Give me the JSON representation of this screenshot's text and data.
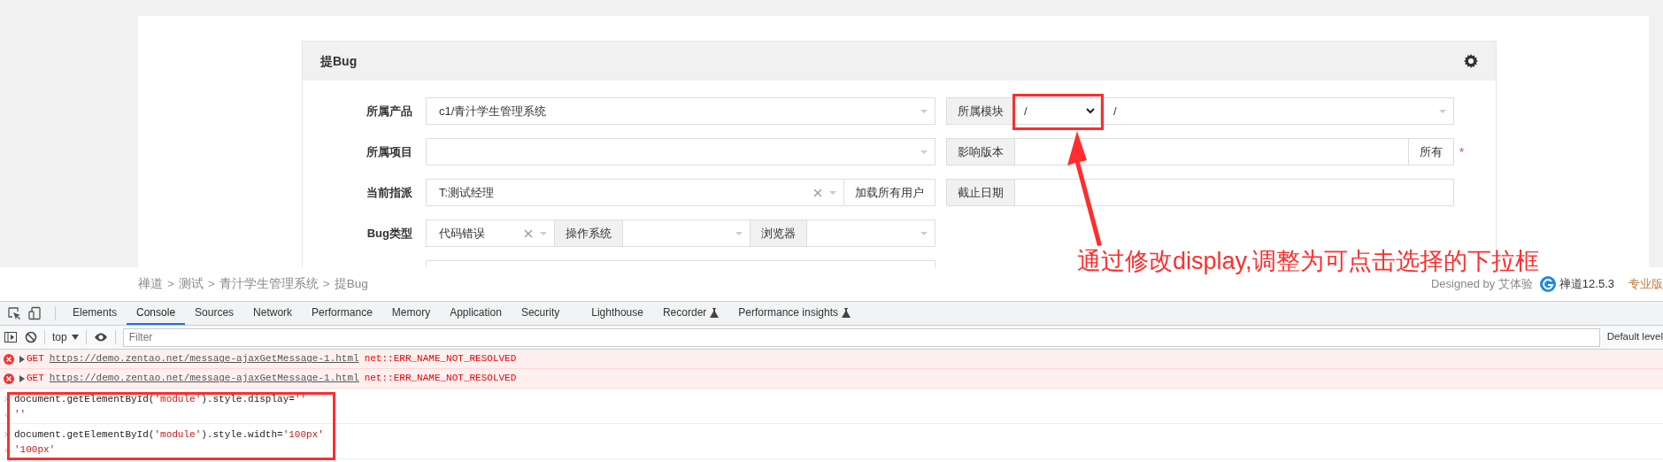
{
  "form": {
    "title": "提Bug",
    "rows": [
      {
        "label": "所属产品",
        "left": [
          {
            "kind": "select",
            "value": "c1/青汁学生管理系统"
          }
        ],
        "right": [
          {
            "kind": "addon",
            "text": "所属模块"
          },
          {
            "kind": "native-select",
            "value": "/"
          },
          {
            "kind": "select",
            "value": "/"
          }
        ]
      },
      {
        "label": "所属项目",
        "left": [
          {
            "kind": "select"
          }
        ],
        "right": [
          {
            "kind": "addon",
            "text": "影响版本"
          },
          {
            "kind": "input"
          },
          {
            "kind": "button",
            "text": "所有"
          }
        ],
        "required_mark": "*"
      },
      {
        "label": "当前指派",
        "left": [
          {
            "kind": "select",
            "value": "T:测试经理",
            "clearable": true
          },
          {
            "kind": "button",
            "text": "加载所有用户"
          }
        ],
        "right": [
          {
            "kind": "addon",
            "text": "截止日期"
          },
          {
            "kind": "input"
          }
        ]
      },
      {
        "label": "Bug类型",
        "left": [
          {
            "kind": "select",
            "value": "代码错误",
            "clearable": true
          },
          {
            "kind": "addon",
            "text": "操作系统"
          },
          {
            "kind": "select"
          },
          {
            "kind": "addon",
            "text": "浏览器"
          },
          {
            "kind": "select"
          }
        ]
      },
      {
        "left": [
          {
            "kind": "input"
          }
        ]
      }
    ]
  },
  "breadcrumb": [
    "禅道",
    ">",
    "测试",
    ">",
    "青汁学生管理系统",
    ">",
    "提Bug"
  ],
  "footer": {
    "designed_by": "Designed by 艾体验",
    "version": "禅道12.5.3",
    "edition": "专业版"
  },
  "annotation": {
    "text": "通过修改display,调整为可点击选择的下拉框"
  },
  "devtools": {
    "tabs": [
      {
        "label": "Elements",
        "selected": false
      },
      {
        "label": "Console",
        "selected": true
      },
      {
        "label": "Sources",
        "selected": false
      },
      {
        "label": "Network",
        "selected": false
      },
      {
        "label": "Performance",
        "selected": false
      },
      {
        "label": "Memory",
        "selected": false
      },
      {
        "label": "Application",
        "selected": false
      },
      {
        "label": "Security",
        "selected": false
      },
      {
        "label": "Lighthouse",
        "selected": false
      },
      {
        "label": "Recorder",
        "selected": false,
        "experimental": true
      },
      {
        "label": "Performance insights",
        "selected": false,
        "experimental": true
      }
    ],
    "context": "top",
    "filter_placeholder": "Filter",
    "level": "Default level",
    "messages": [
      {
        "kind": "error",
        "method": "GET",
        "url": "https://demo.zentao.net/message-ajaxGetMessage-1.html",
        "error": "net::ERR_NAME_NOT_RESOLVED"
      },
      {
        "kind": "error",
        "method": "GET",
        "url": "https://demo.zentao.net/message-ajaxGetMessage-1.html",
        "error": "net::ERR_NAME_NOT_RESOLVED"
      },
      {
        "kind": "input",
        "code": "document.getElementById('module').style.display=''"
      },
      {
        "kind": "result",
        "code": "''"
      },
      {
        "kind": "input",
        "code": "document.getElementById('module').style.width='100px'"
      },
      {
        "kind": "result",
        "code": "'100px'"
      }
    ]
  }
}
